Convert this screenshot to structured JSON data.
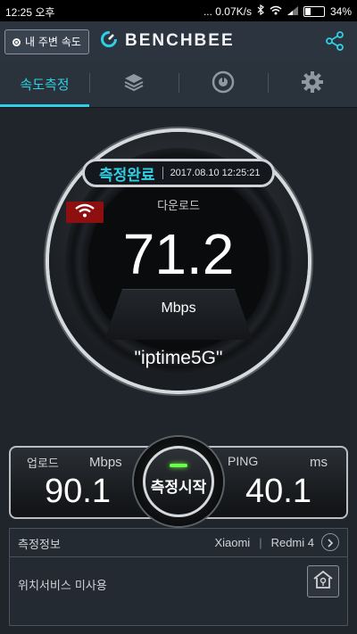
{
  "status_bar": {
    "time": "12:25 오후",
    "net_speed": "... 0.07K/s",
    "battery": "34%",
    "battery_level": 0.34
  },
  "header": {
    "local_speed_label": "내 주변 속도",
    "logo_text": "BENCHBEE"
  },
  "tabs": [
    {
      "label": "속도측정",
      "active": true,
      "icon": "speed-text"
    },
    {
      "label": "",
      "active": false,
      "icon": "layers-icon"
    },
    {
      "label": "",
      "active": false,
      "icon": "history-icon"
    },
    {
      "label": "",
      "active": false,
      "icon": "gear-icon"
    }
  ],
  "gauge": {
    "status_label": "측정완료",
    "timestamp": "2017.08.10 12:25:21",
    "download_label": "다운로드",
    "download_value": "71.2",
    "download_unit": "Mbps",
    "ssid": "\"iptime5G\""
  },
  "results": {
    "upload_label": "업로드",
    "upload_unit": "Mbps",
    "upload_value": "90.1",
    "ping_label": "PING",
    "ping_unit": "ms",
    "ping_value": "40.1",
    "start_button": "측정시작"
  },
  "info": {
    "title": "측정정보",
    "device_maker": "Xiaomi",
    "device_model": "Redmi 4",
    "location_service": "위치서비스 미사용"
  },
  "colors": {
    "accent": "#2ed0e6",
    "wifi_badge": "#8e0f0f",
    "led": "#6cff4a"
  }
}
